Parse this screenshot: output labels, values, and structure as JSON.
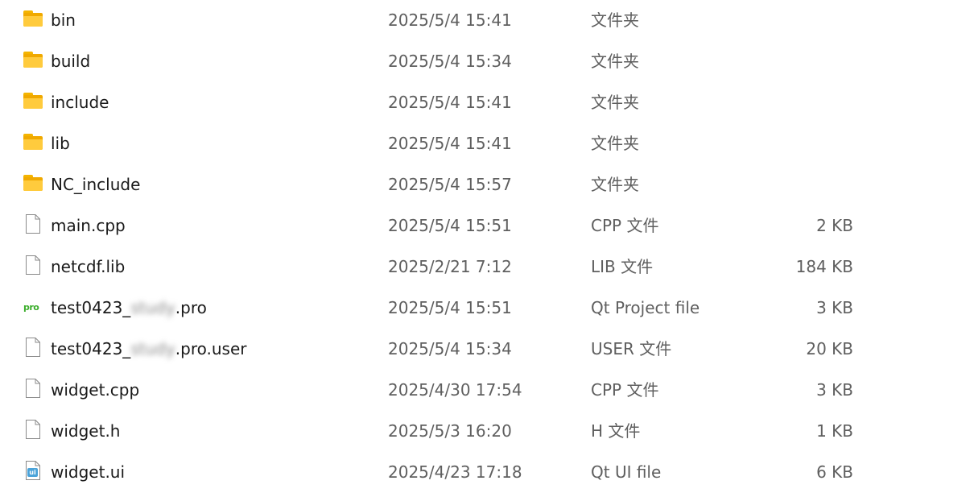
{
  "files": [
    {
      "name": "bin",
      "date": "2025/5/4 15:41",
      "type": "文件夹",
      "size": "",
      "icon": "folder-icon"
    },
    {
      "name": "build",
      "date": "2025/5/4 15:34",
      "type": "文件夹",
      "size": "",
      "icon": "folder-icon"
    },
    {
      "name": "include",
      "date": "2025/5/4 15:41",
      "type": "文件夹",
      "size": "",
      "icon": "folder-icon"
    },
    {
      "name": "lib",
      "date": "2025/5/4 15:41",
      "type": "文件夹",
      "size": "",
      "icon": "folder-icon"
    },
    {
      "name": "NC_include",
      "date": "2025/5/4 15:57",
      "type": "文件夹",
      "size": "",
      "icon": "folder-icon"
    },
    {
      "name": "main.cpp",
      "date": "2025/5/4 15:51",
      "type": "CPP 文件",
      "size": "2 KB",
      "icon": "document-icon"
    },
    {
      "name": "netcdf.lib",
      "date": "2025/2/21 7:12",
      "type": "LIB 文件",
      "size": "184 KB",
      "icon": "document-icon"
    },
    {
      "name_prefix": "test0423_",
      "name_blurred": "study",
      "name_suffix": ".pro",
      "date": "2025/5/4 15:51",
      "type": "Qt Project file",
      "size": "3 KB",
      "icon": "qt-pro-icon",
      "badge": "pro"
    },
    {
      "name_prefix": "test0423_",
      "name_blurred": "study",
      "name_suffix": ".pro.user",
      "date": "2025/5/4 15:34",
      "type": "USER 文件",
      "size": "20 KB",
      "icon": "document-icon"
    },
    {
      "name": "widget.cpp",
      "date": "2025/4/30 17:54",
      "type": "CPP 文件",
      "size": "3 KB",
      "icon": "document-icon"
    },
    {
      "name": "widget.h",
      "date": "2025/5/3 16:20",
      "type": "H 文件",
      "size": "1 KB",
      "icon": "document-icon"
    },
    {
      "name": "widget.ui",
      "date": "2025/4/23 17:18",
      "type": "Qt UI file",
      "size": "6 KB",
      "icon": "qt-ui-icon",
      "badge": "ui"
    }
  ],
  "colors": {
    "folder": "#ffcb3d",
    "qt_pro_badge": "#3cae2c",
    "qt_ui_badge": "#4ba3d9",
    "secondary_text": "#5f5f5f"
  }
}
